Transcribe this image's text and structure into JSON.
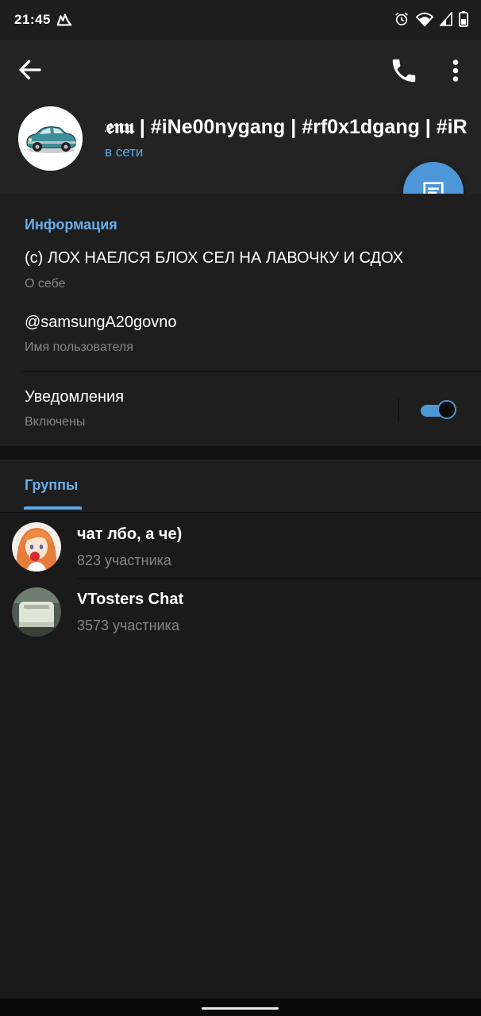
{
  "status_bar": {
    "time": "21:45",
    "icons": [
      "app-notification-icon",
      "alarm-icon",
      "wifi-icon",
      "signal-icon",
      "battery-icon"
    ]
  },
  "header": {
    "profile_name": "𝖒𝖊𝖓𝖚 | #iNe00nygang | #rf0x1dgang | #iR",
    "profile_status": "в сети",
    "icons": [
      "back-arrow-icon",
      "phone-icon",
      "more-vertical-icon",
      "message-icon"
    ]
  },
  "info": {
    "section_title": "Информация",
    "bio": "(с) ЛОХ НАЕЛСЯ БЛОХ СЕЛ НА ЛАВОЧКУ И СДОХ",
    "bio_label": "О себе",
    "username": "@samsungA20govno",
    "username_label": "Имя пользователя",
    "notifications_title": "Уведомления",
    "notifications_state": "Включены",
    "notifications_enabled": true
  },
  "tabs": {
    "groups_label": "Группы"
  },
  "groups": [
    {
      "name": "чат лбо, а че)",
      "members": "823 участника"
    },
    {
      "name": "VTosters Chat",
      "members": "3573 участника"
    }
  ],
  "colors": {
    "accent": "#5ea9e6",
    "fab": "#4d96d8",
    "background": "#1a1a1a",
    "header": "#232323",
    "secondary_text": "#858585"
  }
}
